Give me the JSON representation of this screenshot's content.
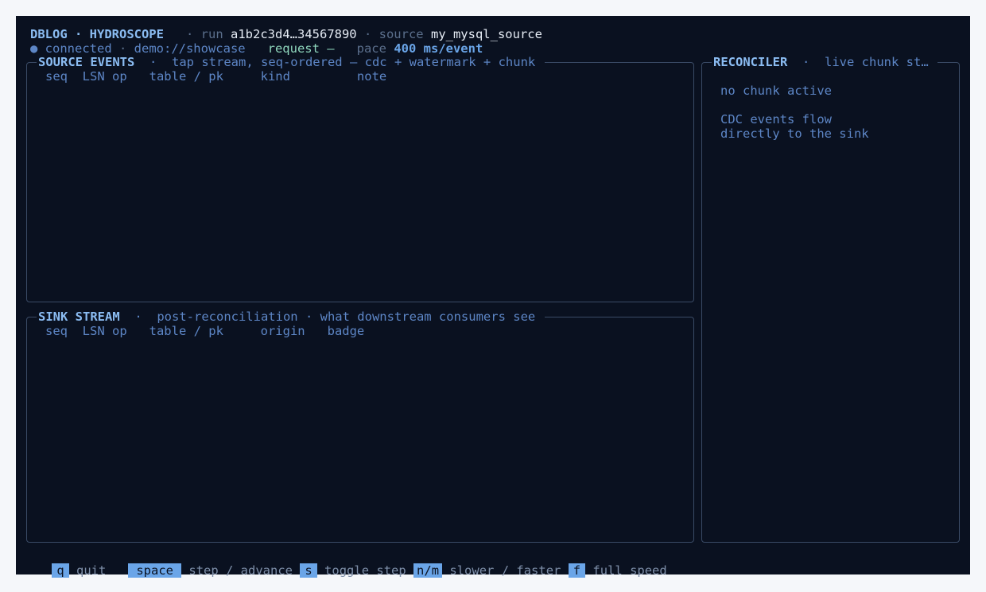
{
  "header": {
    "app": "DBLOG · HYDROSCOPE",
    "run_label": "run",
    "run_id": "a1b2c3d4…34567890",
    "source_label": "source",
    "source_name": "my_mysql_source",
    "status": "● connected",
    "uri": "demo://showcase",
    "request": "request –",
    "pace_label": "pace",
    "pace_value": "400 ms/event"
  },
  "source_panel": {
    "title": "SOURCE EVENTS",
    "subtitle": "tap stream, seq-ordered — cdc + watermark + chunk",
    "columns": "seq  LSN op   table / pk     kind         note"
  },
  "sink_panel": {
    "title": "SINK STREAM",
    "subtitle": "post-reconciliation · what downstream consumers see",
    "columns": "seq  LSN op   table / pk     origin   badge"
  },
  "reconciler_panel": {
    "title": "RECONCILER",
    "subtitle": "live chunk st…",
    "line1": "no chunk active",
    "line2": "CDC events flow",
    "line3": "directly to the sink"
  },
  "footer": {
    "keys": [
      {
        "key": "q",
        "label": "quit"
      },
      {
        "key": "space",
        "label": "step / advance"
      },
      {
        "key": "s",
        "label": "toggle step"
      },
      {
        "key": "n/m",
        "label": "slower / faster"
      },
      {
        "key": "f",
        "label": "full speed"
      }
    ]
  }
}
